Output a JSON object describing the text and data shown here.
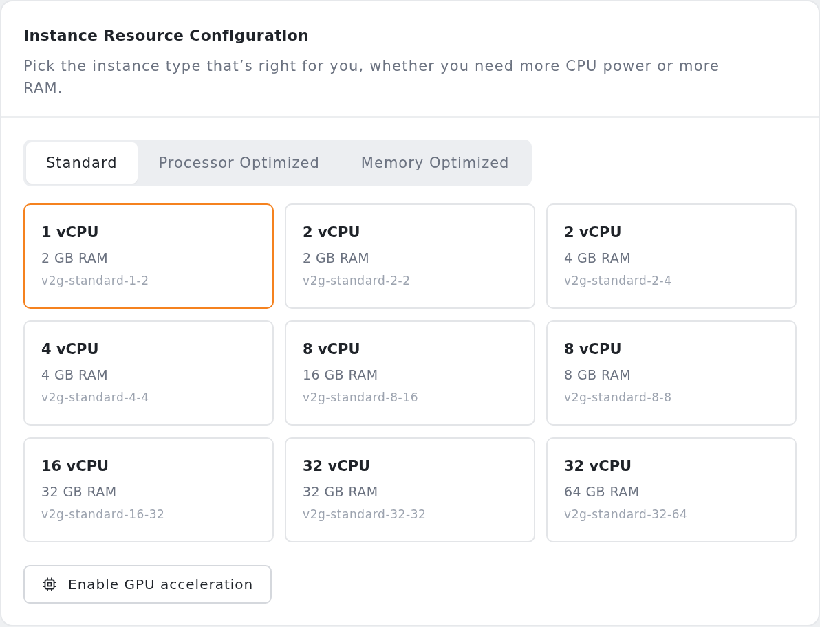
{
  "header": {
    "title": "Instance Resource Configuration",
    "description": "Pick the instance type that’s right for you, whether you need more CPU power or more RAM."
  },
  "tabs": [
    {
      "label": "Standard",
      "selected": true
    },
    {
      "label": "Processor Optimized",
      "selected": false
    },
    {
      "label": "Memory Optimized",
      "selected": false
    }
  ],
  "instances": [
    {
      "vcpu": "1 vCPU",
      "ram": "2 GB RAM",
      "type_id": "v2g-standard-1-2",
      "selected": true
    },
    {
      "vcpu": "2 vCPU",
      "ram": "2 GB RAM",
      "type_id": "v2g-standard-2-2",
      "selected": false
    },
    {
      "vcpu": "2 vCPU",
      "ram": "4 GB RAM",
      "type_id": "v2g-standard-2-4",
      "selected": false
    },
    {
      "vcpu": "4 vCPU",
      "ram": "4 GB RAM",
      "type_id": "v2g-standard-4-4",
      "selected": false
    },
    {
      "vcpu": "8 vCPU",
      "ram": "16 GB RAM",
      "type_id": "v2g-standard-8-16",
      "selected": false
    },
    {
      "vcpu": "8 vCPU",
      "ram": "8 GB RAM",
      "type_id": "v2g-standard-8-8",
      "selected": false
    },
    {
      "vcpu": "16 vCPU",
      "ram": "32 GB RAM",
      "type_id": "v2g-standard-16-32",
      "selected": false
    },
    {
      "vcpu": "32 vCPU",
      "ram": "32 GB RAM",
      "type_id": "v2g-standard-32-32",
      "selected": false
    },
    {
      "vcpu": "32 vCPU",
      "ram": "64 GB RAM",
      "type_id": "v2g-standard-32-64",
      "selected": false
    }
  ],
  "gpu_button": {
    "label": "Enable GPU acceleration"
  }
}
